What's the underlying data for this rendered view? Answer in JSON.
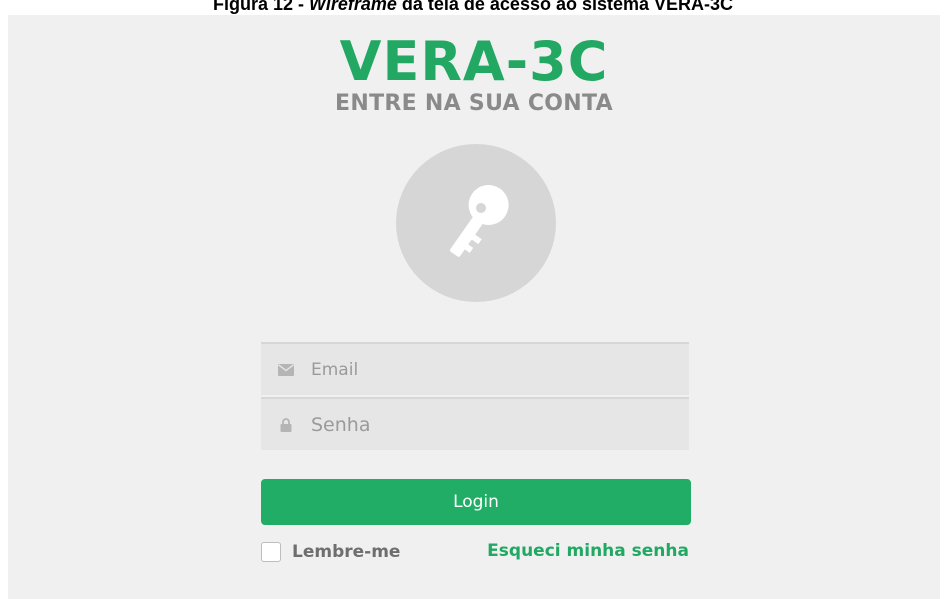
{
  "caption": {
    "prefix": "Figura 12 - ",
    "emphasis": "Wireframe",
    "suffix": " da tela de acesso ao sistema VERA-3C"
  },
  "login": {
    "brand": "VERA-3C",
    "subtitle": "ENTRE NA SUA CONTA",
    "avatar_icon": "key-icon",
    "email": {
      "placeholder": "Email",
      "value": "",
      "icon": "envelope-icon"
    },
    "password": {
      "placeholder": "Senha",
      "value": "",
      "icon": "lock-icon"
    },
    "submit_label": "Login",
    "remember_label": "Lembre-me",
    "remember_checked": false,
    "forgot_label": "Esqueci minha senha"
  },
  "colors": {
    "brand_green": "#22a863",
    "button_green": "#22ad66",
    "panel_bg": "#f0f0f0",
    "subtitle_gray": "#8a8a8a"
  }
}
